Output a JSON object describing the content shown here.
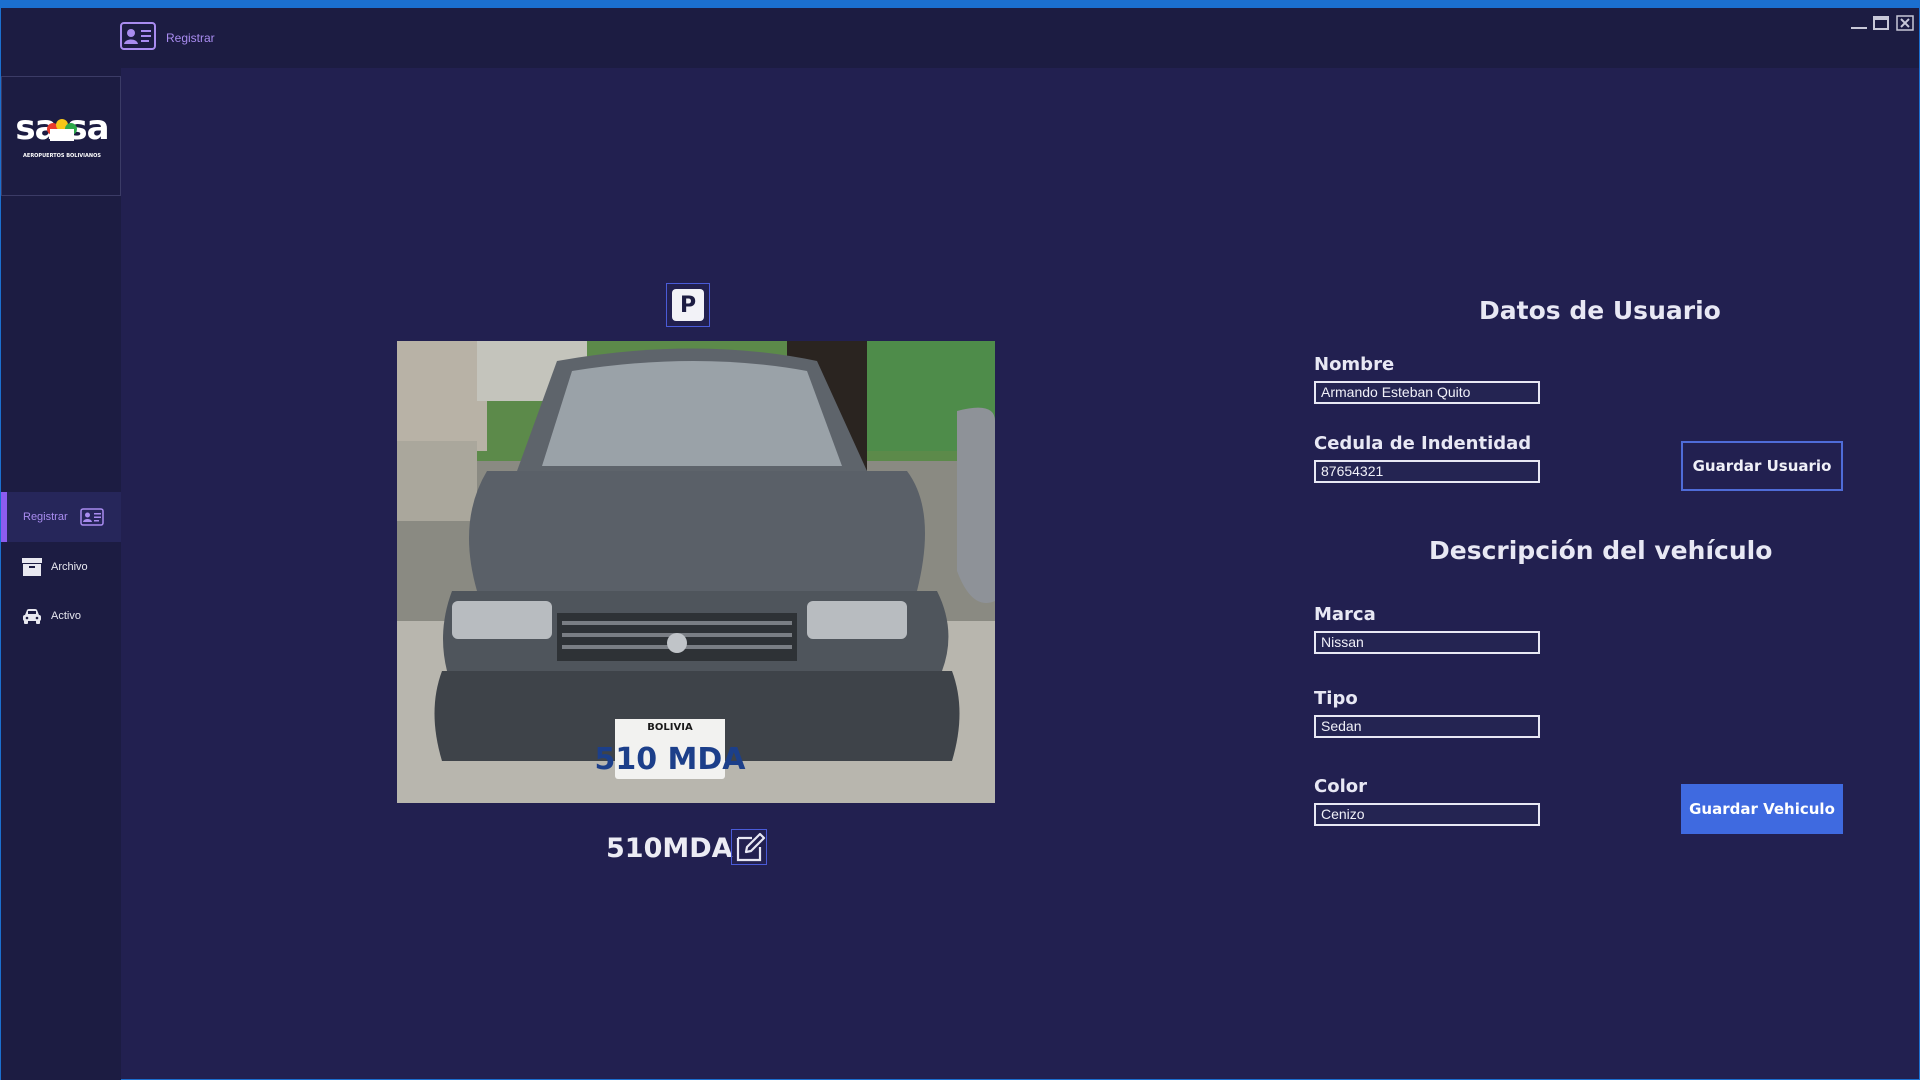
{
  "titlebar": {
    "label": "Registrar",
    "icon": "id-card-icon"
  },
  "logo": {
    "brand": "sabsa",
    "tagline": "AEROPUERTOS BOLIVIANOS"
  },
  "sidebar": {
    "items": [
      {
        "label": "Registrar",
        "icon": "id-card-icon",
        "active": true
      },
      {
        "label": "Archivo",
        "icon": "archive-box-icon",
        "active": false
      },
      {
        "label": "Activo",
        "icon": "car-icon",
        "active": false
      }
    ]
  },
  "parking": {
    "icon": "parking-icon",
    "glyph": "P"
  },
  "vehicle_photo": {
    "plate_country": "BOLIVIA",
    "plate_number": "510 MDA"
  },
  "plate": {
    "text": "510MDA",
    "edit_icon": "edit-icon"
  },
  "user_section": {
    "title": "Datos de Usuario",
    "nombre_label": "Nombre",
    "nombre_value": "Armando Esteban Quito",
    "cedula_label": "Cedula de Indentidad",
    "cedula_value": "87654321",
    "save_label": "Guardar Usuario"
  },
  "vehicle_section": {
    "title": "Descripción del vehículo",
    "marca_label": "Marca",
    "marca_value": "Nissan",
    "tipo_label": "Tipo",
    "tipo_value": "Sedan",
    "color_label": "Color",
    "color_value": "Cenizo",
    "save_label": "Guardar Vehiculo"
  },
  "colors": {
    "accent": "#8c5cf0",
    "button_primary": "#3f6ae0",
    "background": "#222050",
    "sidebar": "#1c1c42"
  }
}
